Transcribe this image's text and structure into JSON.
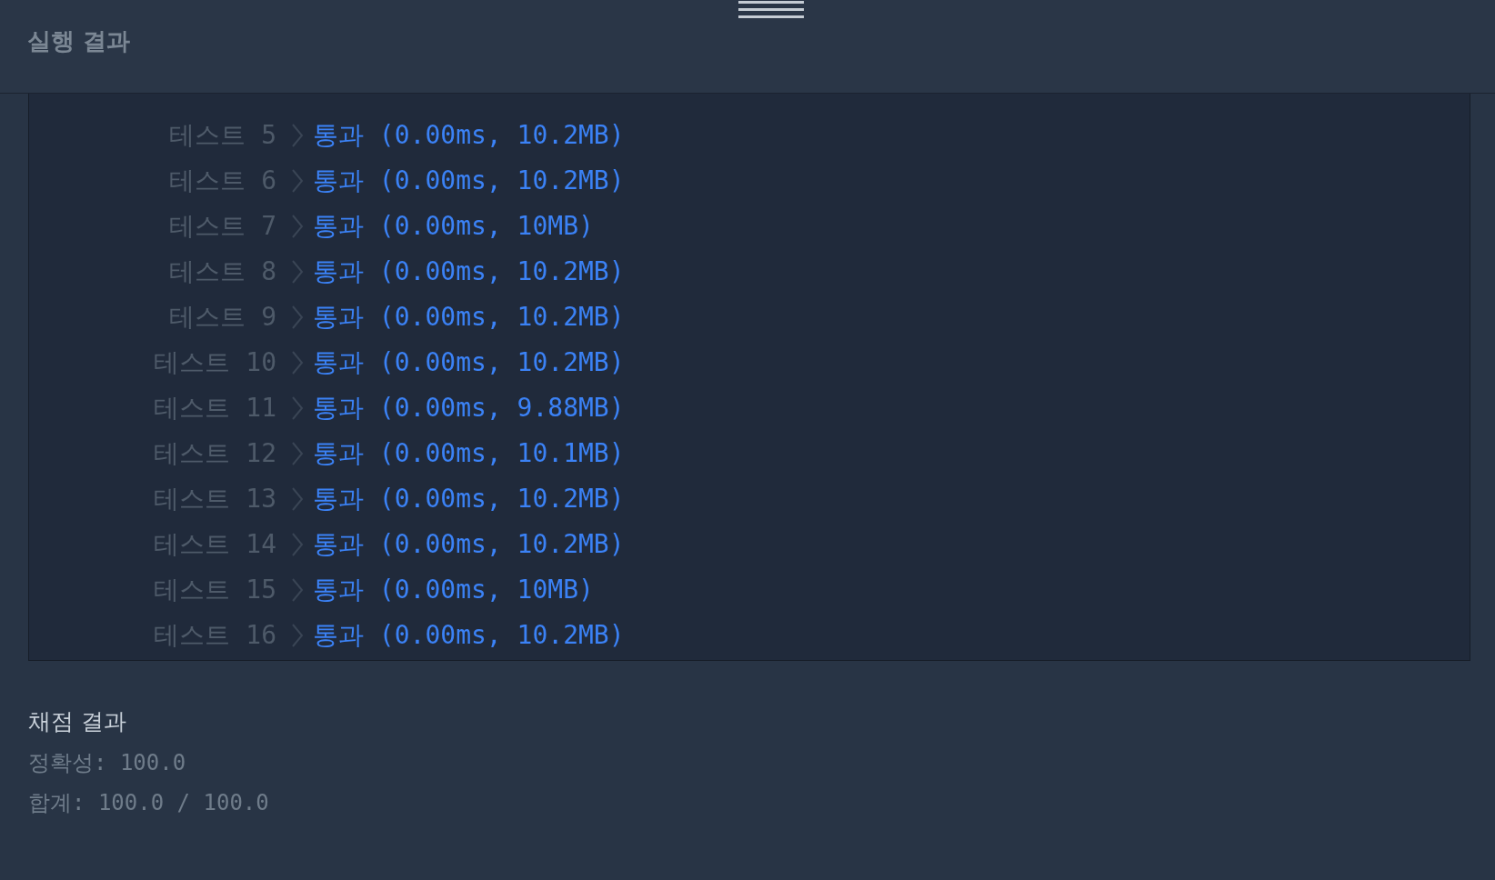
{
  "header": {
    "title": "실행 결과"
  },
  "tests": [
    {
      "label": "테스트 5",
      "kind": "pass",
      "result": "통과",
      "detail": "(0.00ms, 10.2MB)"
    },
    {
      "label": "테스트 6",
      "kind": "pass",
      "result": "통과",
      "detail": "(0.00ms, 10.2MB)"
    },
    {
      "label": "테스트 7",
      "kind": "pass",
      "result": "통과",
      "detail": "(0.00ms, 10MB)"
    },
    {
      "label": "테스트 8",
      "kind": "pass",
      "result": "통과",
      "detail": "(0.00ms, 10.2MB)"
    },
    {
      "label": "테스트 9",
      "kind": "pass",
      "result": "통과",
      "detail": "(0.00ms, 10.2MB)"
    },
    {
      "label": "테스트 10",
      "kind": "pass",
      "result": "통과",
      "detail": "(0.00ms, 10.2MB)"
    },
    {
      "label": "테스트 11",
      "kind": "pass",
      "result": "통과",
      "detail": "(0.00ms, 9.88MB)"
    },
    {
      "label": "테스트 12",
      "kind": "pass",
      "result": "통과",
      "detail": "(0.00ms, 10.1MB)"
    },
    {
      "label": "테스트 13",
      "kind": "pass",
      "result": "통과",
      "detail": "(0.00ms, 10.2MB)"
    },
    {
      "label": "테스트 14",
      "kind": "pass",
      "result": "통과",
      "detail": "(0.00ms, 10.2MB)"
    },
    {
      "label": "테스트 15",
      "kind": "pass",
      "result": "통과",
      "detail": "(0.00ms, 10MB)"
    },
    {
      "label": "테스트 16",
      "kind": "pass",
      "result": "통과",
      "detail": "(0.00ms, 10.2MB)"
    }
  ],
  "grading": {
    "title": "채점 결과",
    "lines": [
      "정확성: 100.0",
      "합계: 100.0 / 100.0"
    ]
  }
}
